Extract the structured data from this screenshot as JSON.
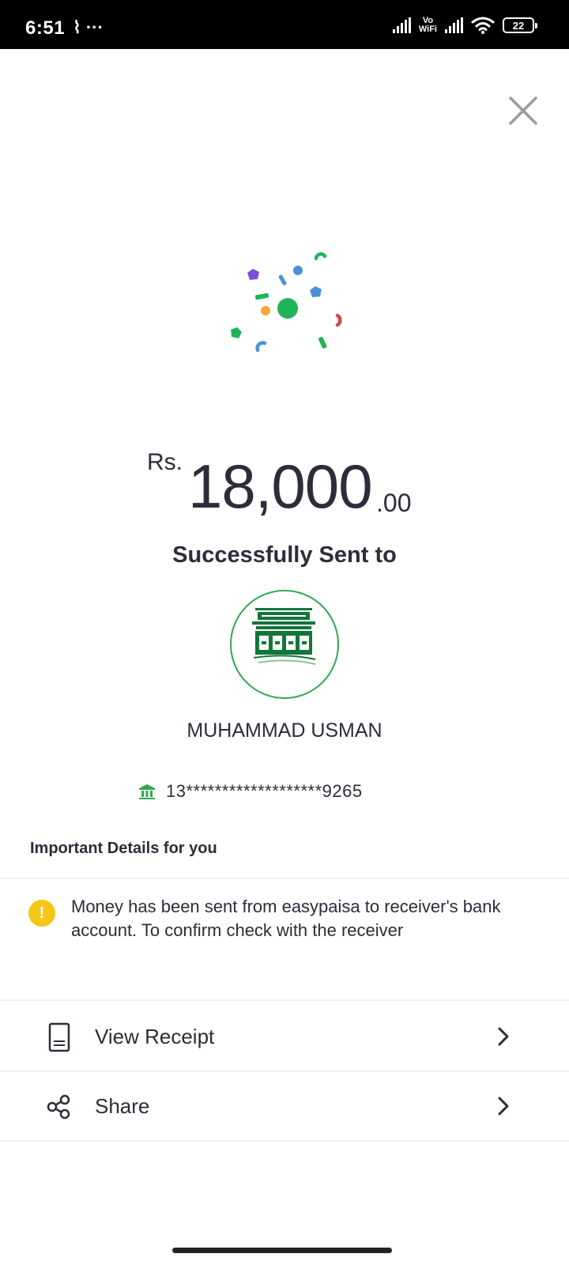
{
  "status_bar": {
    "time": "6:51",
    "extra": "⌇ ···",
    "vowifi_top": "Vo",
    "vowifi_bottom": "WiFi",
    "battery": "22"
  },
  "transaction": {
    "currency": "Rs.",
    "amount_main": "18,000",
    "amount_decimal": ".00",
    "status_text": "Successfully Sent to",
    "recipient_name": "MUHAMMAD USMAN",
    "account_number": "13*******************9265"
  },
  "details": {
    "title": "Important Details for you",
    "notice_icon": "!",
    "notice_text": "Money has been sent from easypaisa to receiver's bank account. To confirm check with the receiver"
  },
  "actions": [
    {
      "label": "View Receipt",
      "icon": "receipt-icon"
    },
    {
      "label": "Share",
      "icon": "share-icon"
    }
  ],
  "colors": {
    "accent_green": "#2fa84f",
    "warning_yellow": "#f5c518",
    "text_dark": "#2b2d3a"
  }
}
